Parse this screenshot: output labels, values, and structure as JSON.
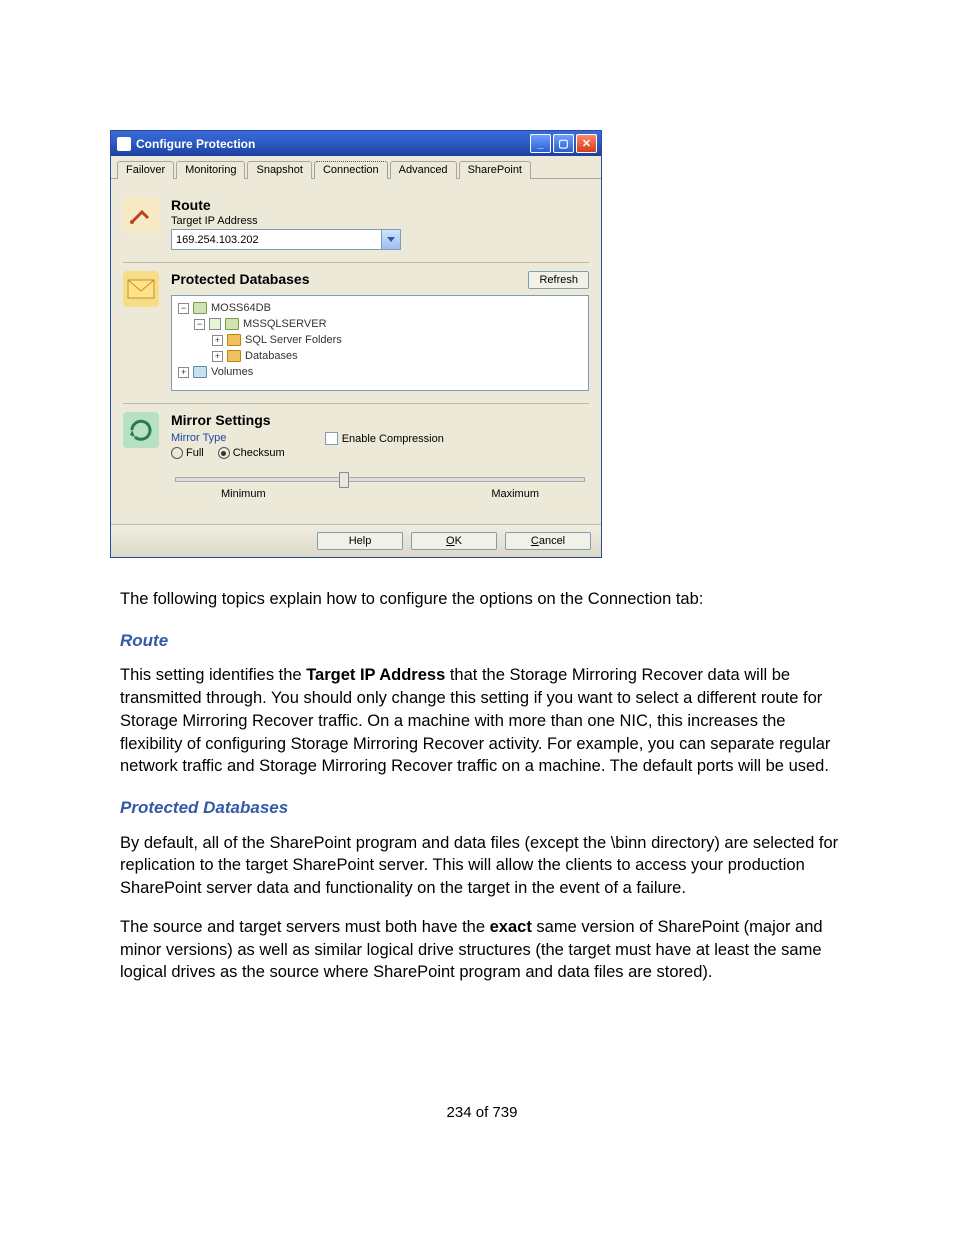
{
  "dialog": {
    "title": "Configure Protection",
    "tabs": [
      "Failover",
      "Monitoring",
      "Snapshot",
      "Connection",
      "Advanced",
      "SharePoint"
    ],
    "active_tab_index": 3,
    "route": {
      "heading": "Route",
      "label": "Target IP Address",
      "value": "169.254.103.202"
    },
    "protected": {
      "heading": "Protected Databases",
      "refresh_label": "Refresh",
      "tree": {
        "server": "MOSS64DB",
        "instance": "MSSQLSERVER",
        "folders_label": "SQL Server Folders",
        "databases_label": "Databases",
        "volumes_label": "Volumes"
      }
    },
    "mirror": {
      "heading": "Mirror Settings",
      "type_label": "Mirror Type",
      "radio_full": "Full",
      "radio_checksum": "Checksum",
      "selected_radio": "checksum",
      "enable_compression": "Enable Compression",
      "min_label": "Minimum",
      "max_label": "Maximum"
    },
    "buttons": {
      "help": "Help",
      "ok": "OK",
      "cancel": "Cancel"
    }
  },
  "doc": {
    "para_intro": "The following topics explain how to configure the options on the Connection tab:",
    "h_route": "Route",
    "para_route_1": "This setting identifies the ",
    "para_route_bold": "Target IP Address",
    "para_route_2": " that the Storage Mirroring Recover data will be transmitted through. You should only change this setting if you want to select a different route for Storage Mirroring Recover traffic. On a machine with more than one NIC, this increases the flexibility of configuring Storage Mirroring Recover activity. For example, you can separate regular network traffic and Storage Mirroring Recover traffic on a machine. The default ports will be used.",
    "h_protected": "Protected Databases",
    "para_prot": "By default, all of the SharePoint program and data files (except the \\binn directory) are selected for replication to the target SharePoint server. This will allow the clients to access your production SharePoint server data and functionality on the target in the event of a failure.",
    "para_exact_1": "The source and target servers must both have the ",
    "para_exact_bold": "exact",
    "para_exact_2": " same version of SharePoint (major and minor versions) as well as similar logical drive structures (the target must have at least the same logical drives as the source where SharePoint program and data files are stored).",
    "page_number": "234 of 739"
  }
}
